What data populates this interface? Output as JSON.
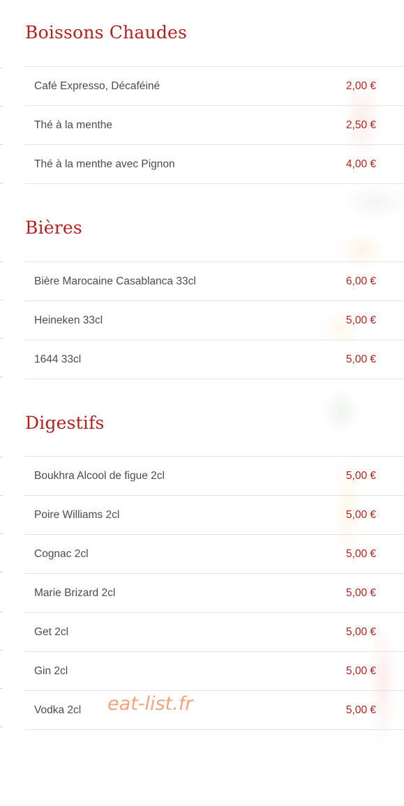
{
  "sections": [
    {
      "title": "Boissons Chaudes",
      "items": [
        {
          "name": "Café Expresso, Décaféiné",
          "price": "2,00 €"
        },
        {
          "name": "Thé à la menthe",
          "price": "2,50 €"
        },
        {
          "name": "Thé à la menthe avec Pignon",
          "price": "4,00 €"
        }
      ]
    },
    {
      "title": "Bières",
      "items": [
        {
          "name": "Bière Marocaine Casablanca 33cl",
          "price": "6,00 €"
        },
        {
          "name": "Heineken 33cl",
          "price": "5,00 €"
        },
        {
          "name": "1644 33cl",
          "price": "5,00 €"
        }
      ]
    },
    {
      "title": "Digestifs",
      "items": [
        {
          "name": "Boukhra Alcool de figue 2cl",
          "price": "5,00 €"
        },
        {
          "name": "Poire Williams 2cl",
          "price": "5,00 €"
        },
        {
          "name": "Cognac 2cl",
          "price": "5,00 €"
        },
        {
          "name": "Marie Brizard 2cl",
          "price": "5,00 €"
        },
        {
          "name": "Get 2cl",
          "price": "5,00 €"
        },
        {
          "name": "Gin 2cl",
          "price": "5,00 €"
        },
        {
          "name": "Vodka 2cl",
          "price": "5,00 €"
        }
      ]
    }
  ],
  "watermark": "eat-list.fr",
  "colors": {
    "accent": "#b3211e",
    "text": "#4c4c4c",
    "divider": "#e3e3e3",
    "watermark": "#f3a47d"
  }
}
